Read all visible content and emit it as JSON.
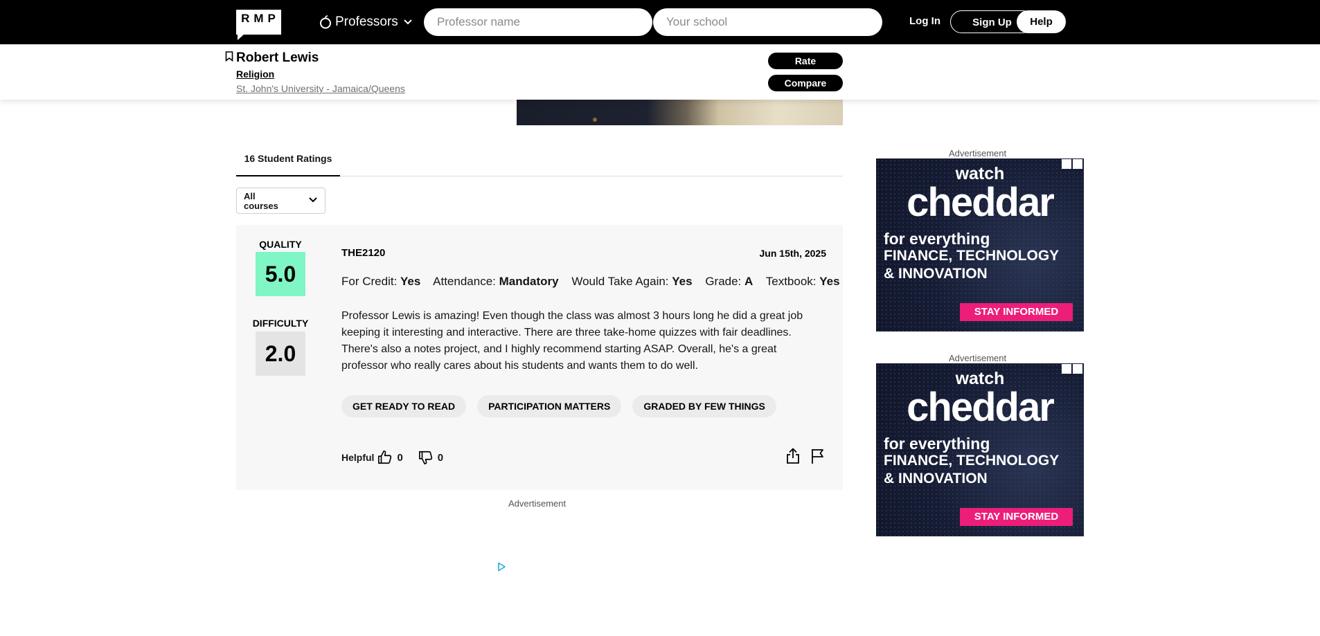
{
  "nav": {
    "logo": "RMP",
    "search_type": "Professors",
    "professor_placeholder": "Professor name",
    "school_placeholder": "Your school",
    "login": "Log In",
    "signup": "Sign Up",
    "help": "Help"
  },
  "header": {
    "name": "Robert Lewis",
    "department": "Religion",
    "school": "St. John's University - Jamaica/Queens",
    "rate": "Rate",
    "compare": "Compare"
  },
  "tabs": {
    "ratings": "16 Student Ratings"
  },
  "filter": {
    "course": "All courses"
  },
  "rating": {
    "quality_label": "QUALITY",
    "quality": "5.0",
    "difficulty_label": "DIFFICULTY",
    "difficulty": "2.0",
    "course": "THE2120",
    "date": "Jun 15th, 2025",
    "meta": [
      {
        "label": "For Credit:",
        "value": "Yes"
      },
      {
        "label": "Attendance:",
        "value": "Mandatory"
      },
      {
        "label": "Would Take Again:",
        "value": "Yes"
      },
      {
        "label": "Grade:",
        "value": "A"
      },
      {
        "label": "Textbook:",
        "value": "Yes"
      }
    ],
    "comment": "Professor Lewis is amazing! Even though the class was almost 3 hours long he did a great job keeping it interesting and interactive. There are three take-home quizzes with fair deadlines. There's also a notes project, and I highly recommend starting ASAP. Overall, he's a great professor who really cares about his students and wants them to do well.",
    "tags": [
      "GET READY TO READ",
      "PARTICIPATION MATTERS",
      "GRADED BY FEW THINGS"
    ],
    "helpful_label": "Helpful",
    "thumbs_up": "0",
    "thumbs_down": "0"
  },
  "ads": {
    "label": "Advertisement",
    "watch": "watch",
    "brand": "cheddar",
    "line1": "for everything",
    "line2": "FINANCE, TECHNOLOGY",
    "line3": "& INNOVATION",
    "cta": "STAY INFORMED"
  },
  "colors": {
    "quality_bg": "#7ff6c3",
    "difficulty_bg": "#e4e4e4",
    "ad_cta": "#ec1e79"
  }
}
